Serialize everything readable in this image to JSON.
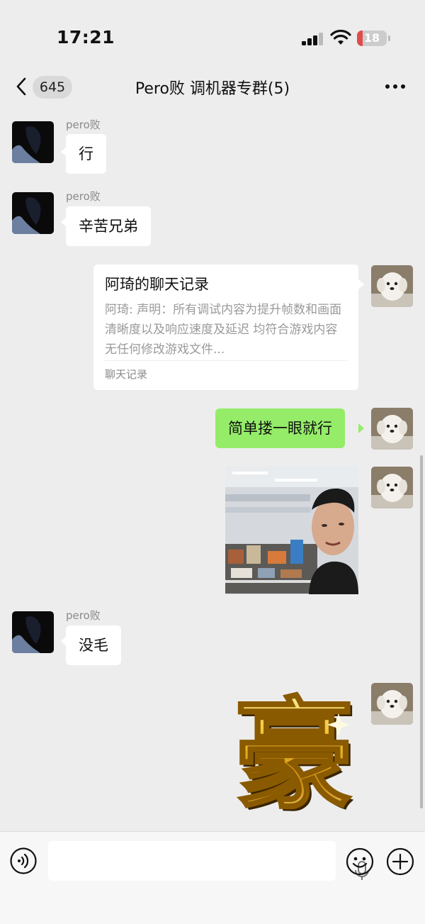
{
  "status": {
    "time": "17:21",
    "battery": "18"
  },
  "nav": {
    "badge": "645",
    "title": "Pero败 调机器专群(5)"
  },
  "messages": [
    {
      "sender": "pero败",
      "text": "行"
    },
    {
      "sender": "pero败",
      "text": "辛苦兄弟"
    },
    {
      "card_title": "阿琦的聊天记录",
      "card_preview": "阿琦: 声明：所有调试内容为提升帧数和画面清晰度以及响应速度及延迟  均符合游戏内容  无任何修改游戏文件...",
      "card_footer": "聊天记录"
    },
    {
      "text": "简单搂一眼就行"
    },
    {
      "sender": "pero败",
      "text": "没毛"
    },
    {
      "sticker_text": "豪"
    }
  ],
  "colors": {
    "green_bubble": "#95ec69",
    "background": "#ededed",
    "battery_low": "#e24b4b"
  },
  "icons": [
    "chevron-left-icon",
    "more-dots-icon",
    "voice-icon",
    "microphone-icon",
    "emoji-icon",
    "plus-icon"
  ]
}
